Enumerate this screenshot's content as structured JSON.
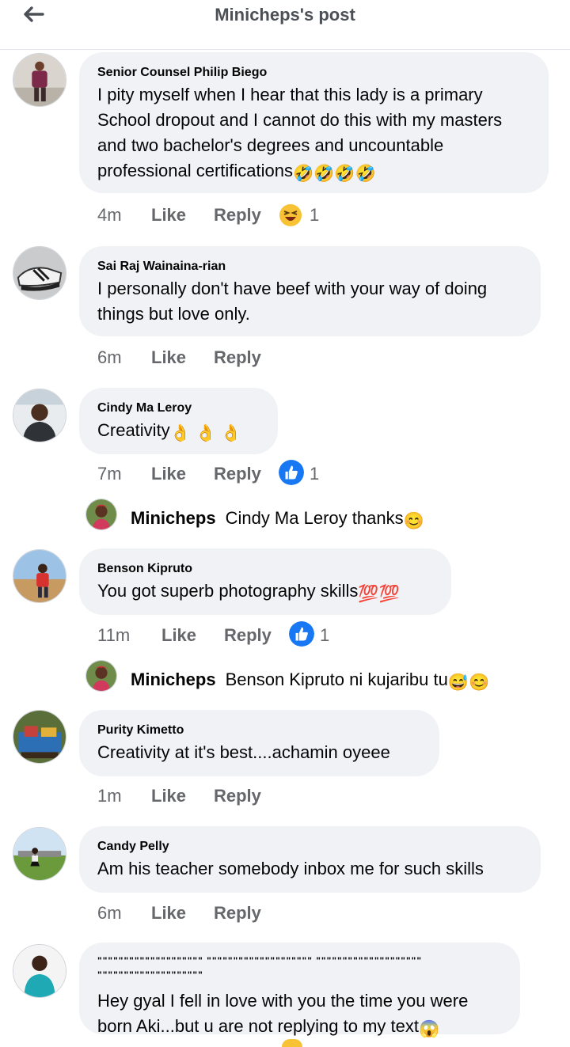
{
  "header": {
    "title": "Minicheps's post",
    "back_icon": "arrow-left-icon"
  },
  "comments": [
    {
      "name": "Senior Counsel Philip Biego",
      "text": "I pity myself when I hear that this lady is a primary School dropout and I cannot do this with my masters and two bachelor's degrees and uncountable professional certifications",
      "emoji_suffix": "🤣🤣🤣🤣",
      "time": "4m",
      "like": "Like",
      "reply": "Reply",
      "reaction_icon": "laughing-face-icon",
      "reaction_count": "1"
    },
    {
      "name": "Sai Raj Wainaina-rian",
      "text": "I personally don't have beef with your way of doing things but love only.",
      "time": "6m",
      "like": "Like",
      "reply": "Reply"
    },
    {
      "name": "Cindy Ma Leroy",
      "text": "Creativity",
      "emoji_suffix": " 👌 👌 👌",
      "time": "7m",
      "like": "Like",
      "reply": "Reply",
      "reaction_icon": "thumbs-up-icon",
      "reaction_count": "1"
    },
    {
      "name": "Benson Kipruto",
      "text": "You got superb photography skills",
      "emoji_suffix": "💯💯",
      "time": "11m",
      "like": "Like",
      "reply": "Reply",
      "reaction_icon": "thumbs-up-icon",
      "reaction_count": "1"
    },
    {
      "name": "Purity Kimetto",
      "text": "Creativity at it's best....achamin oyeee",
      "time": "1m",
      "like": "Like",
      "reply": "Reply"
    },
    {
      "name": "Candy Pelly",
      "text": "Am his teacher somebody inbox me for such skills",
      "time": "6m",
      "like": "Like",
      "reply": "Reply"
    },
    {
      "name": "\"\"\"\"\"\"\"\"\"\"\"\"\"\"\"\"\"\"\"\" \"\"\"\"\"\"\"\"\"\"\"\"\"\"\"\"\"\"\"\" \"\"\"\"\"\"\"\"\"\"\"\"\"\"\"\"\"\"\"\" \"\"\"\"\"\"\"\"\"\"\"\"\"\"\"\"\"\"\"\"",
      "text": "Hey gyal I fell in love with you the time you were born Aki...but u are not replying to my text",
      "emoji_suffix": "😱"
    }
  ],
  "replies": [
    {
      "name": "Minicheps",
      "text": "Cindy Ma Leroy thanks",
      "emoji_suffix": " 😊"
    },
    {
      "name": "Minicheps",
      "text": "Benson Kipruto ni kujaribu tu",
      "emoji_suffix": "😅😊"
    }
  ],
  "colors": {
    "bubble": "#f0f2f5",
    "meta_text": "#65676b",
    "like_blue": "#1877f2",
    "header_text": "#4b4f56"
  }
}
